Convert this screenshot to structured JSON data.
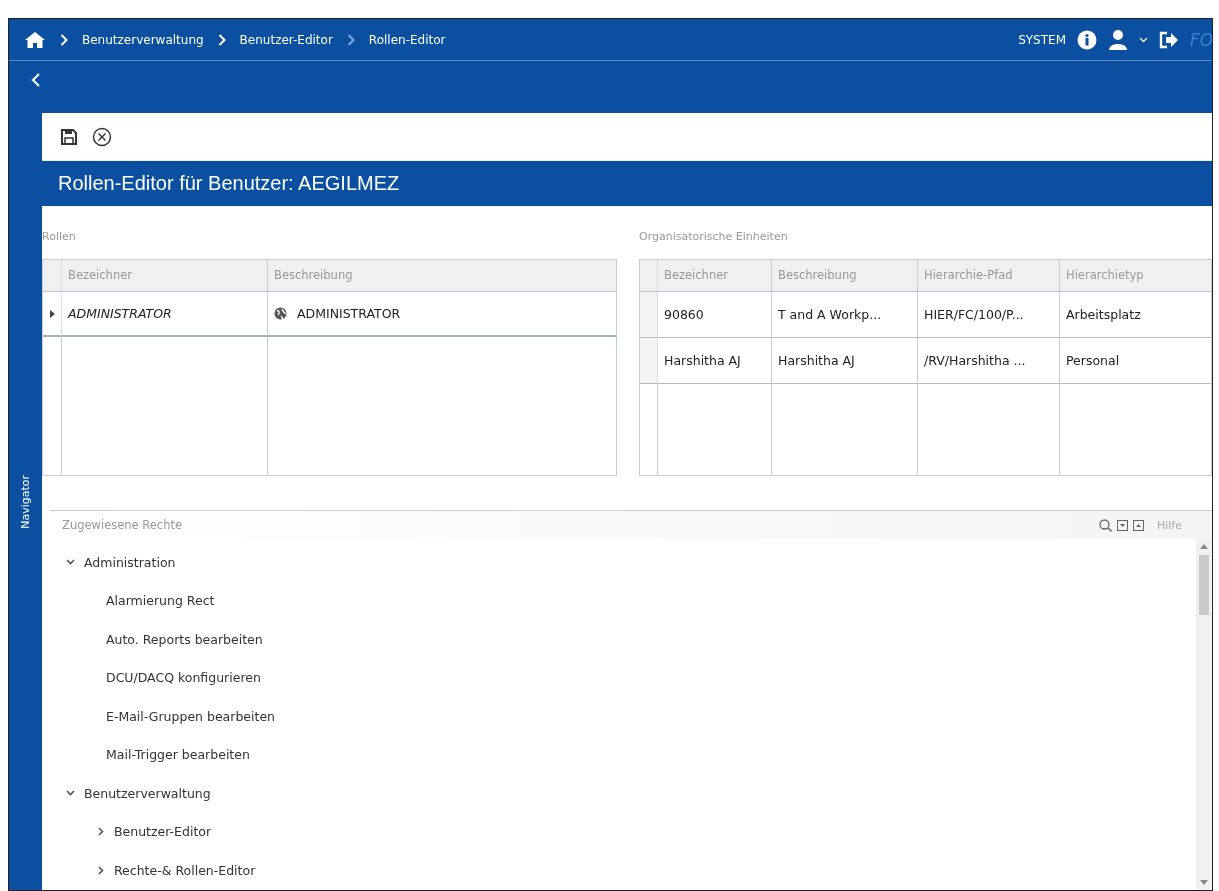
{
  "header": {
    "breadcrumbs": [
      "Benutzerverwaltung",
      "Benutzer-Editor",
      "Rollen-Editor"
    ],
    "user": "SYSTEM",
    "logo": "FO"
  },
  "title": "Rollen-Editor für Benutzer: AEGILMEZ",
  "navigator": {
    "label": "Navigator"
  },
  "roles": {
    "label": "Rollen",
    "columns": [
      "Bezeichner",
      "Beschreibung"
    ],
    "rows": [
      {
        "cells": [
          "ADMINISTRATOR",
          "ADMINISTRATOR"
        ],
        "selected": true
      }
    ]
  },
  "units": {
    "label": "Organisatorische Einheiten",
    "columns": [
      "Bezeichner",
      "Beschreibung",
      "Hierarchie-Pfad",
      "Hierarchietyp"
    ],
    "rows": [
      {
        "cells": [
          "90860",
          "T and A Workp...",
          "HIER/FC/100/P...",
          "Arbeitsplatz"
        ],
        "selected": false
      },
      {
        "cells": [
          "Harshitha AJ",
          "Harshitha AJ",
          "/RV/Harshitha ...",
          "Personal"
        ],
        "selected": false
      }
    ]
  },
  "rights": {
    "label": "Zugewiesene Rechte",
    "help": "Hilfe",
    "tree": [
      {
        "label": "Administration",
        "expanded": true,
        "children": [
          {
            "label": "Alarmierung Rect"
          },
          {
            "label": "Auto. Reports bearbeiten"
          },
          {
            "label": "DCU/DACQ konfigurieren"
          },
          {
            "label": "E-Mail-Gruppen bearbeiten"
          },
          {
            "label": "Mail-Trigger bearbeiten"
          }
        ]
      },
      {
        "label": "Benutzerverwaltung",
        "expanded": true,
        "children": [
          {
            "label": "Benutzer-Editor",
            "expanded": false
          },
          {
            "label": "Rechte-& Rollen-Editor",
            "expanded": false
          }
        ]
      }
    ]
  }
}
